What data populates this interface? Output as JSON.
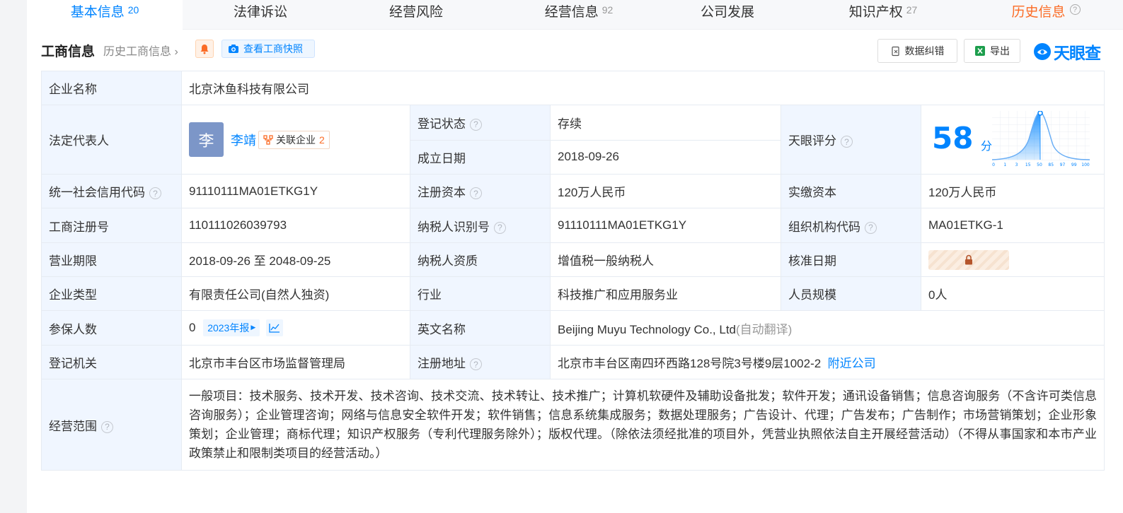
{
  "tabs": [
    {
      "label": "基本信息",
      "count": "20"
    },
    {
      "label": "法律诉讼",
      "count": ""
    },
    {
      "label": "经营风险",
      "count": ""
    },
    {
      "label": "经营信息",
      "count": "92"
    },
    {
      "label": "公司发展",
      "count": ""
    },
    {
      "label": "知识产权",
      "count": "27"
    },
    {
      "label": "历史信息",
      "count": ""
    }
  ],
  "section": {
    "title": "工商信息",
    "history_link": "历史工商信息",
    "snapshot_button": "查看工商快照",
    "correct_button": "数据纠错",
    "export_button": "导出",
    "brand": "天眼查"
  },
  "info": {
    "name_label": "企业名称",
    "name_value": "北京沐鱼科技有限公司",
    "legal_label": "法定代表人",
    "legal_avatar": "李",
    "legal_name": "李靖",
    "related_label": "关联企业",
    "related_count": "2",
    "status_label": "登记状态",
    "status_value": "存续",
    "found_label": "成立日期",
    "found_value": "2018-09-26",
    "score_label": "天眼评分",
    "score_value": "58",
    "score_unit": "分",
    "score_ticks": [
      "0",
      "1",
      "3",
      "15",
      "50",
      "85",
      "97",
      "99",
      "100"
    ],
    "uscc_label": "统一社会信用代码",
    "uscc_value": "91110111MA01ETKG1Y",
    "regcap_label": "注册资本",
    "regcap_value": "120万人民币",
    "paid_label": "实缴资本",
    "paid_value": "120万人民币",
    "regno_label": "工商注册号",
    "regno_value": "110111026039793",
    "taxid_label": "纳税人识别号",
    "taxid_value": "91110111MA01ETKG1Y",
    "orgcode_label": "组织机构代码",
    "orgcode_value": "MA01ETKG-1",
    "term_label": "营业期限",
    "term_value": "2018-09-26 至 2048-09-25",
    "taxqual_label": "纳税人资质",
    "taxqual_value": "增值税一般纳税人",
    "approve_label": "核准日期",
    "type_label": "企业类型",
    "type_value": "有限责任公司(自然人独资)",
    "industry_label": "行业",
    "industry_value": "科技推广和应用服务业",
    "staff_label": "人员规模",
    "staff_value": "0人",
    "insured_label": "参保人数",
    "insured_value": "0",
    "insured_year": "2023年报",
    "en_label": "英文名称",
    "en_value": "Beijing Muyu Technology Co., Ltd",
    "en_note": "(自动翻译)",
    "authority_label": "登记机关",
    "authority_value": "北京市丰台区市场监督管理局",
    "address_label": "注册地址",
    "address_value": "北京市丰台区南四环西路128号院3号楼9层1002-2",
    "nearby_link": "附近公司",
    "scope_label": "经营范围",
    "scope_value": "一般项目：技术服务、技术开发、技术咨询、技术交流、技术转让、技术推广；计算机软硬件及辅助设备批发；软件开发；通讯设备销售；信息咨询服务（不含许可类信息咨询服务）；企业管理咨询；网络与信息安全软件开发；软件销售；信息系统集成服务；数据处理服务；广告设计、代理；广告发布；广告制作；市场营销策划；企业形象策划；企业管理；商标代理；知识产权服务（专利代理服务除外）；版权代理。（除依法须经批准的项目外，凭营业执照依法自主开展经营活动）（不得从事国家和本市产业政策禁止和限制类项目的经营活动。）"
  }
}
